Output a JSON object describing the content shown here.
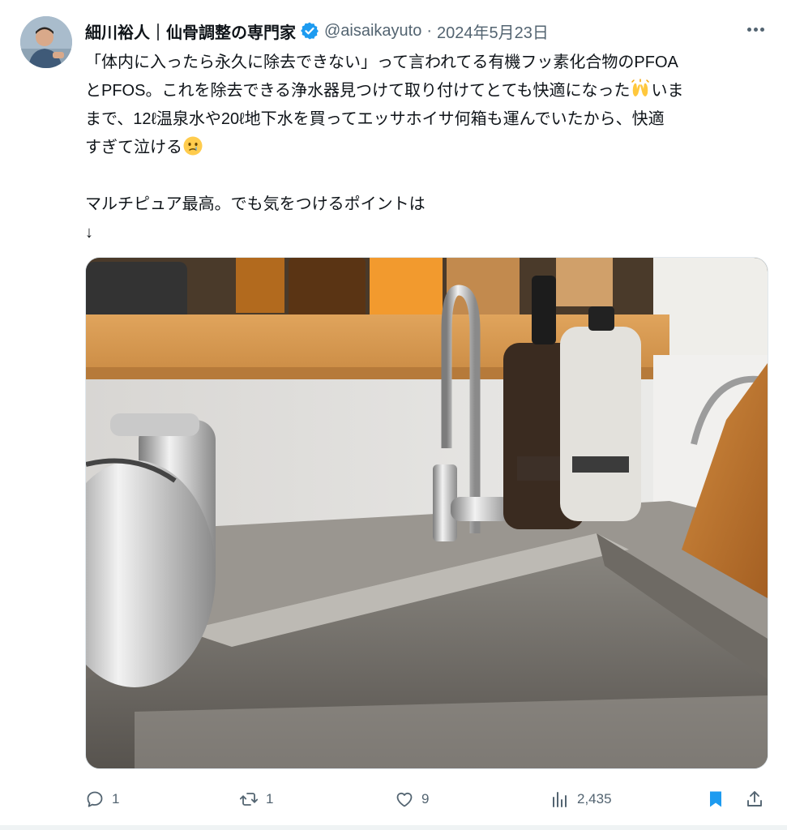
{
  "author": {
    "name": "細川裕人｜仙骨調整の専門家",
    "handle": "@aisaikayuto",
    "separator": "·",
    "date": "2024年5月23日",
    "verified": true
  },
  "tweet": {
    "lines": [
      "「体内に入ったら永久に除去できない」って言われてる有機フッ素化合物のPFOA",
      "とPFOS。これを除去できる浄水器見つけて取り付けてとても快適になった",
      "いま",
      "まで、12ℓ温泉水や20ℓ地下水を買ってエッサホイサ何箱も運んでいたから、快適",
      "すぎて泣ける",
      "マルチピュア最高。でも気をつけるポイントは",
      "↓"
    ],
    "emojis": [
      "raising-hands",
      "face-holding-back-tears"
    ]
  },
  "media": {
    "description_icons": "photo"
  },
  "actions": {
    "reply_count": "1",
    "retweet_count": "1",
    "like_count": "9",
    "views_count": "2,435"
  },
  "colors": {
    "text": "#0f1419",
    "muted": "#536471",
    "verified": "#1d9bf0",
    "bookmark": "#1d9bf0"
  }
}
